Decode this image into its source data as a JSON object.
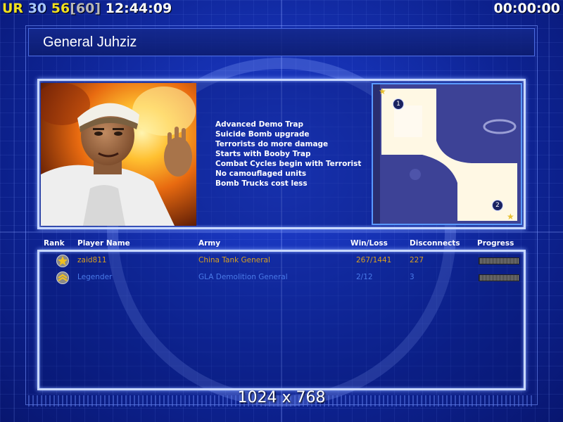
{
  "hud": {
    "rank_tag": "UR",
    "num_a": "30",
    "num_b": "56",
    "bracket": "[60]",
    "clock": "12:44:09",
    "timer": "00:00:00"
  },
  "general": {
    "name": "General Juhziz",
    "bonuses": [
      "Advanced Demo Trap",
      "Suicide Bomb upgrade",
      "Terrorists do more damage",
      "Starts with Booby Trap",
      "Combat Cycles begin with Terrorist",
      "No camouflaged units",
      "Bomb Trucks cost less"
    ]
  },
  "minimap": {
    "start_1": "1",
    "start_2": "2"
  },
  "table": {
    "headers": {
      "rank": "Rank",
      "player_name": "Player Name",
      "army": "Army",
      "win_loss": "Win/Loss",
      "disconnects": "Disconnects",
      "progress": "Progress"
    },
    "rows": [
      {
        "name": "zaid811",
        "army": "China Tank General",
        "win_loss": "267/1441",
        "disconnects": "227",
        "rank_icon": "gold-star-rank-icon",
        "color": "#d8a020"
      },
      {
        "name": "Legender",
        "army": "GLA Demolition General",
        "win_loss": "2/12",
        "disconnects": "3",
        "rank_icon": "chevron-rank-icon",
        "color": "#4a7ae8"
      }
    ]
  },
  "footer": {
    "resolution": "1024 x 768"
  }
}
